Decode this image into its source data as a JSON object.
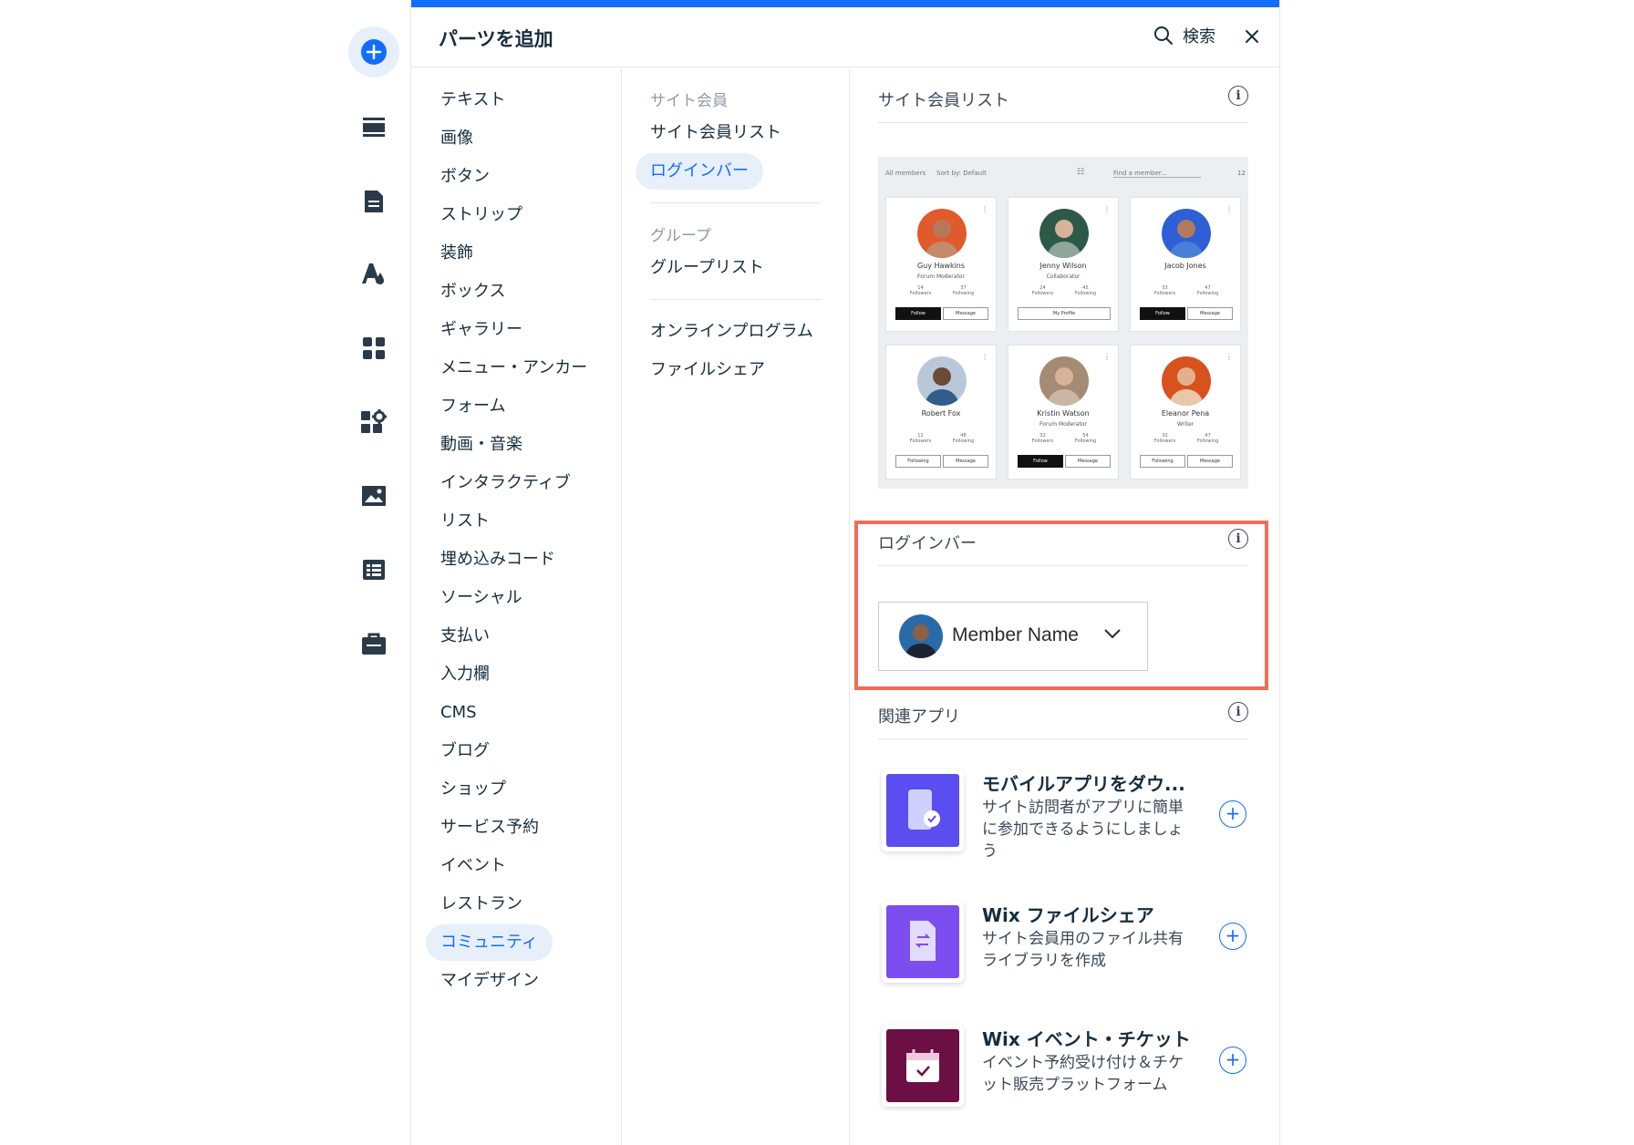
{
  "panel": {
    "title": "パーツを追加",
    "search_label": "検索"
  },
  "rail": {
    "icons": [
      "add-icon",
      "strips-icon",
      "page-icon",
      "theme-icon",
      "apps-icon",
      "extensions-icon",
      "media-icon",
      "cms-icon",
      "business-icon"
    ]
  },
  "categories": [
    {
      "label": "テキスト"
    },
    {
      "label": "画像"
    },
    {
      "label": "ボタン"
    },
    {
      "label": "ストリップ"
    },
    {
      "label": "装飾"
    },
    {
      "label": "ボックス"
    },
    {
      "label": "ギャラリー"
    },
    {
      "label": "メニュー・アンカー"
    },
    {
      "label": "フォーム"
    },
    {
      "label": "動画・音楽"
    },
    {
      "label": "インタラクティブ"
    },
    {
      "label": "リスト"
    },
    {
      "label": "埋め込みコード"
    },
    {
      "label": "ソーシャル"
    },
    {
      "label": "支払い"
    },
    {
      "label": "入力欄"
    },
    {
      "label": "CMS"
    },
    {
      "label": "ブログ"
    },
    {
      "label": "ショップ"
    },
    {
      "label": "サービス予約"
    },
    {
      "label": "イベント"
    },
    {
      "label": "レストラン"
    },
    {
      "label": "コミュニティ",
      "active": true
    },
    {
      "label": "マイデザイン"
    }
  ],
  "subcategories": {
    "group1_title": "サイト会員",
    "group1_items": [
      "サイト会員リスト",
      "ログインバー"
    ],
    "group2_title": "グループ",
    "group2_items": [
      "グループリスト"
    ],
    "group3_items": [
      "オンラインプログラム",
      "ファイルシェア"
    ]
  },
  "sections": {
    "members_list": "サイト会員リスト",
    "login_bar": "ログインバー",
    "related_apps": "関連アプリ"
  },
  "preview": {
    "filter_all": "All members",
    "sort": "Sort by: Default",
    "find_placeholder": "Find a member...",
    "count": "12",
    "members": [
      {
        "name": "Guy Hawkins",
        "role": "Forum Moderator",
        "followers": "14",
        "following": "37",
        "btn1": "Follow",
        "btn2": "Message"
      },
      {
        "name": "Jenny Wilson",
        "role": "Collaborator",
        "followers": "24",
        "following": "45",
        "btn1": "My Profile",
        "btn2": ""
      },
      {
        "name": "Jacob Jones",
        "role": "",
        "followers": "33",
        "following": "47",
        "btn1": "Follow",
        "btn2": "Message"
      },
      {
        "name": "Robert Fox",
        "role": "",
        "followers": "12",
        "following": "48",
        "btn1": "Following",
        "btn2": "Message"
      },
      {
        "name": "Kristin Watson",
        "role": "Forum Moderator",
        "followers": "32",
        "following": "54",
        "btn1": "Follow",
        "btn2": "Message"
      },
      {
        "name": "Eleanor Pena",
        "role": "Writer",
        "followers": "32",
        "following": "47",
        "btn1": "Following",
        "btn2": "Message"
      }
    ],
    "followers_label": "Followers",
    "following_label": "Following"
  },
  "login_bar": {
    "member_name": "Member Name"
  },
  "apps": [
    {
      "name": "モバイルアプリをダウ...",
      "desc": "サイト訪問者がアプリに簡単に参加できるようにしましょう",
      "color": "#5b4ef0"
    },
    {
      "name": "Wix ファイルシェア",
      "desc": "サイト会員用のファイル共有ライブラリを作成",
      "color": "#7c4ef0"
    },
    {
      "name": "Wix イベント・チケット",
      "desc": "イベント予約受け付け＆チケット販売プラットフォーム",
      "color": "#6b0f45"
    }
  ],
  "colors": {
    "accent": "#116dff",
    "highlight": "#f06e58"
  }
}
